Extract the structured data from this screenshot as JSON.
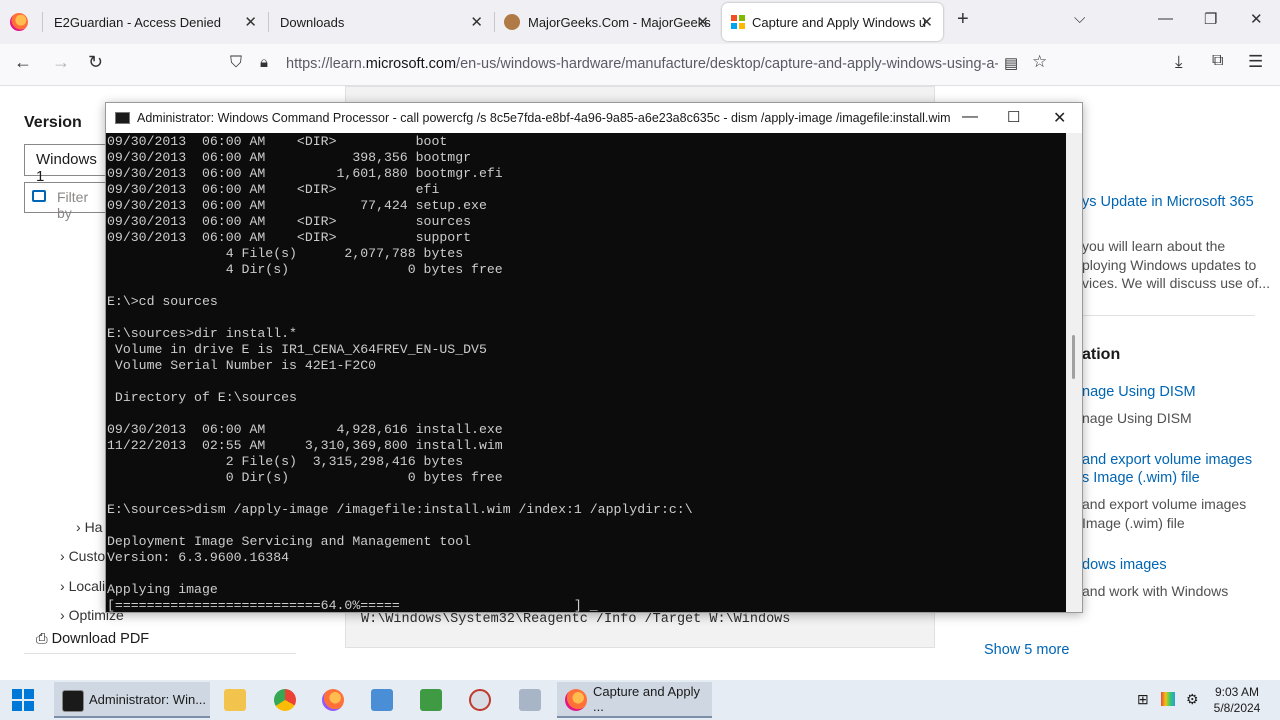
{
  "browser": {
    "tabs": [
      {
        "label": "E2Guardian - Access Denied",
        "close": "✕"
      },
      {
        "label": "Downloads",
        "close": "✕"
      },
      {
        "label": "MajorGeeks.Com - MajorGeeks",
        "close": "✕"
      },
      {
        "label": "Capture and Apply Windows u",
        "close": "✕"
      }
    ],
    "new_tab": "+",
    "url_prefix": "https://learn.",
    "url_domain": "microsoft.com",
    "url_rest": "/en-us/windows-hardware/manufacture/desktop/capture-and-apply-windows-using-a-si"
  },
  "page": {
    "version_heading": "Version",
    "version_select": "Windows 1",
    "filter_placeholder": "Filter by",
    "nav_items": [
      "Ha",
      "Custo",
      "Locali",
      "Optimize"
    ],
    "download_pdf": "Download PDF",
    "code_line": "W:\\Windows\\System32\\Reagentc /Info /Target W:\\Windows",
    "right": {
      "link1": "ys Update in Microsoft 365",
      "text1": [
        "you will learn about the",
        "ploying Windows updates to",
        "vices. We will discuss use of..."
      ],
      "heading": "ation",
      "link2": "nage Using DISM",
      "text2": "nage Using DISM",
      "link3a": "and export volume images",
      "link3b": "s Image (.wim) file",
      "text3a": "and export volume images",
      "text3b": "Image (.wim) file",
      "link4": "dows images",
      "text4": "and work with Windows",
      "show_more": "Show 5 more"
    }
  },
  "cmd": {
    "title": "Administrator: Windows Command Processor - call  powercfg /s 8c5e7fda-e8bf-4a96-9a85-a6e23a8c635c - dism  /apply-image /imagefile:install.wim /i...",
    "lines": [
      "09/30/2013  06:00 AM    <DIR>          boot",
      "09/30/2013  06:00 AM           398,356 bootmgr",
      "09/30/2013  06:00 AM         1,601,880 bootmgr.efi",
      "09/30/2013  06:00 AM    <DIR>          efi",
      "09/30/2013  06:00 AM            77,424 setup.exe",
      "09/30/2013  06:00 AM    <DIR>          sources",
      "09/30/2013  06:00 AM    <DIR>          support",
      "               4 File(s)      2,077,788 bytes",
      "               4 Dir(s)               0 bytes free",
      "",
      "E:\\>cd sources",
      "",
      "E:\\sources>dir install.*",
      " Volume in drive E is IR1_CENA_X64FREV_EN-US_DV5",
      " Volume Serial Number is 42E1-F2C0",
      "",
      " Directory of E:\\sources",
      "",
      "09/30/2013  06:00 AM         4,928,616 install.exe",
      "11/22/2013  02:55 AM     3,310,369,800 install.wim",
      "               2 File(s)  3,315,298,416 bytes",
      "               0 Dir(s)               0 bytes free",
      "",
      "E:\\sources>dism /apply-image /imagefile:install.wim /index:1 /applydir:c:\\",
      "",
      "Deployment Image Servicing and Management tool",
      "Version: 6.3.9600.16384",
      "",
      "Applying image",
      "[==========================64.0%=====                      ] _"
    ],
    "progress": 64.0
  },
  "taskbar": {
    "cmd_label": "Administrator: Win...",
    "firefox_label": "Capture and Apply ...",
    "time": "9:03 AM",
    "date": "5/8/2024"
  }
}
